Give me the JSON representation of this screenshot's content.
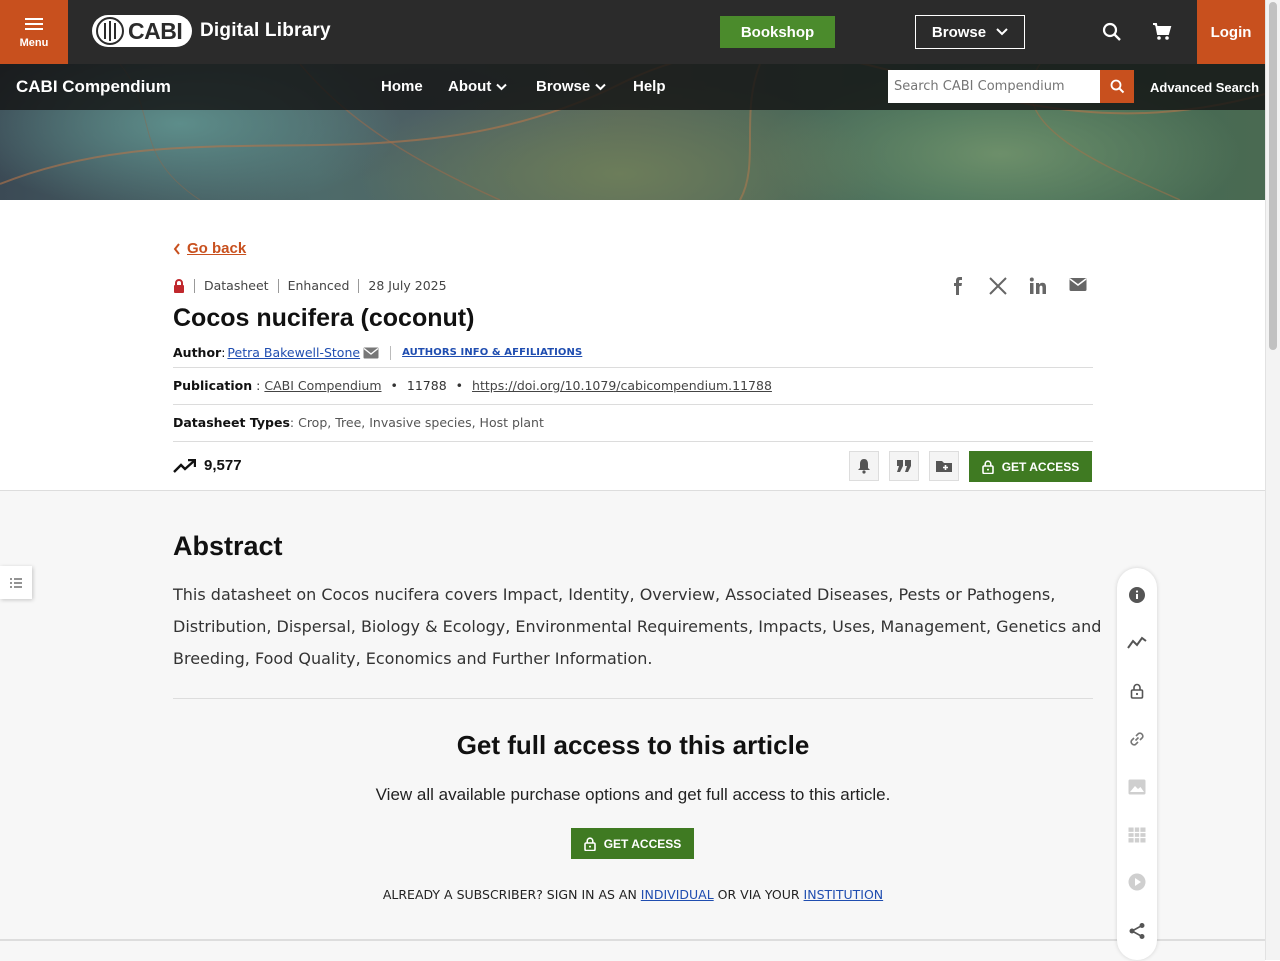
{
  "header": {
    "menu_label": "Menu",
    "logo_text": "CABI",
    "site_name": "Digital Library",
    "bookshop_label": "Bookshop",
    "browse_label": "Browse",
    "login_label": "Login"
  },
  "subnav": {
    "title": "CABI Compendium",
    "items": [
      "Home",
      "About",
      "Browse",
      "Help"
    ],
    "search_placeholder": "Search CABI Compendium",
    "advanced_search": "Advanced Search"
  },
  "article": {
    "go_back": "Go back",
    "meta": [
      "Datasheet",
      "Enhanced",
      "28 July 2025"
    ],
    "title": "Cocos nucifera (coconut)",
    "author_label": "Author",
    "author_name": "Petra Bakewell-Stone",
    "authors_info": "AUTHORS INFO & AFFILIATIONS",
    "publication_label": "Publication",
    "publication_name": "CABI Compendium",
    "publication_number": "11788",
    "doi": "https://doi.org/10.1079/cabicompendium.11788",
    "types_label": "Datasheet Types",
    "types_value": "Crop, Tree, Invasive species, Host plant",
    "views": "9,577",
    "get_access": "GET ACCESS"
  },
  "abstract": {
    "heading": "Abstract",
    "text": "This datasheet on Cocos nucifera covers Impact, Identity, Overview, Associated Diseases, Pests or Pathogens, Distribution, Dispersal, Biology & Ecology, Environmental Requirements, Impacts, Uses, Management, Genetics and Breeding, Food Quality, Economics and Further Information."
  },
  "access": {
    "heading": "Get full access to this article",
    "subtext": "View all available purchase options and get full access to this article.",
    "button": "GET ACCESS",
    "subscriber_prefix": "ALREADY A SUBSCRIBER? SIGN IN AS AN",
    "individual": "INDIVIDUAL",
    "middle": "OR VIA YOUR",
    "institution": "INSTITUTION"
  },
  "colors": {
    "brand_orange": "#c8501e",
    "access_green": "#3f7a22",
    "bookshop_green": "#4b8b2c",
    "link_blue": "#1f4db0"
  },
  "icons": [
    "menu-icon",
    "search-icon",
    "cart-icon",
    "chevron-down-icon",
    "lock-icon",
    "facebook-icon",
    "x-icon",
    "linkedin-icon",
    "email-icon",
    "trending-icon",
    "bell-icon",
    "quote-icon",
    "folder-add-icon",
    "info-icon",
    "chart-icon",
    "link-icon",
    "image-icon",
    "table-icon",
    "play-icon",
    "share-icon",
    "list-icon"
  ]
}
